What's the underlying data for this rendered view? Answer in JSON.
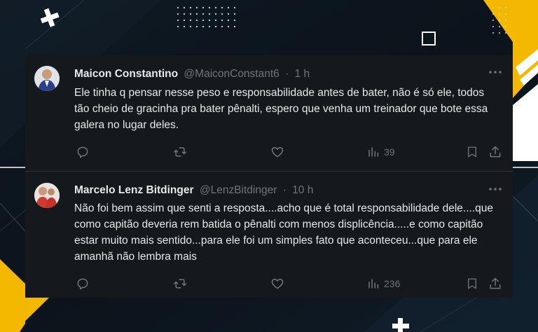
{
  "tweets": [
    {
      "display_name": "Maicon Constantino",
      "handle": "@MaiconConstant6",
      "separator": "·",
      "time": "1 h",
      "text": "Ele tinha q pensar nesse peso e responsabilidade antes de bater, não é só ele, todos tão cheio de gracinha pra bater pênalti, espero que venha um treinador que bote essa galera no lugar deles.",
      "views": "39"
    },
    {
      "display_name": "Marcelo Lenz Bitdinger",
      "handle": "@LenzBitdinger",
      "separator": "·",
      "time": "10 h",
      "text": "Não foi bem assim que senti a resposta....acho que é total responsabilidade dele....que como capitão deveria rem batida o pênalti com menos displicência.....e como capitão estar muito mais sentido...para ele foi um simples fato que aconteceu...que para ele amanhã não lembra mais",
      "views": "236"
    }
  ],
  "icons": {
    "more": "more-horizontal-icon",
    "reply": "reply-icon",
    "retweet": "retweet-icon",
    "like": "heart-icon",
    "views": "views-chart-icon",
    "bookmark": "bookmark-icon",
    "share": "share-icon"
  },
  "colors": {
    "card_bg": "#15181c",
    "text": "#e7e9ea",
    "muted": "#71767b",
    "accent_yellow": "#f5b800",
    "page_bg": "#0d1620"
  }
}
